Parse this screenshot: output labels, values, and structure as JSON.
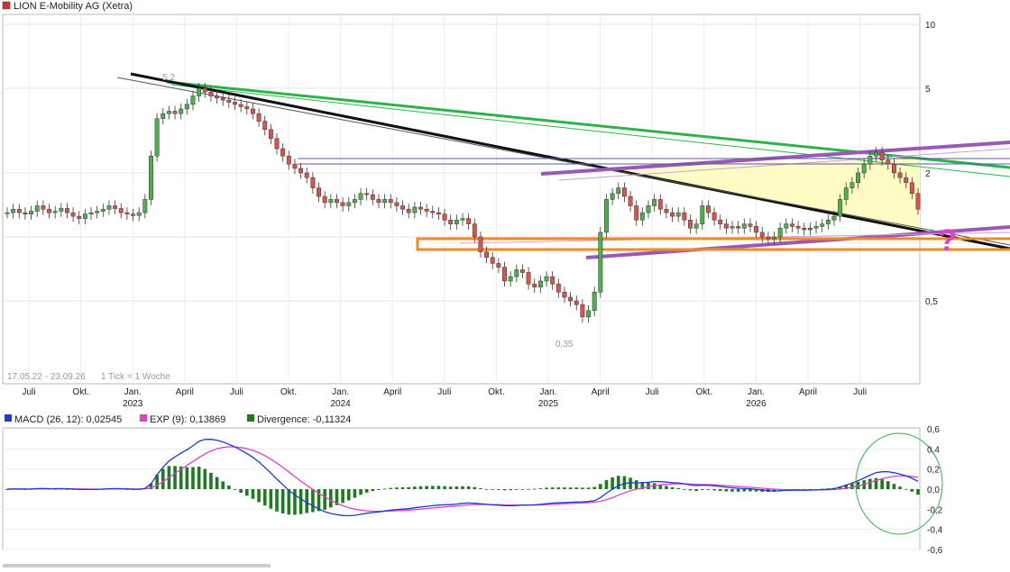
{
  "title": "LION E-Mobility AG (Xetra)",
  "title_color": "#d62d2d",
  "range_text": "17.05.22 - 23.09.26",
  "tick_text": "1 Tick = 1 Woche",
  "price_axis": {
    "labels": [
      "10",
      "5",
      "2",
      "0,5"
    ],
    "scale": "log",
    "range": [
      0.3,
      10
    ]
  },
  "annotations": {
    "high_label": "5,2",
    "low_label": "0,35",
    "question_mark": "?"
  },
  "time_axis": {
    "labels": [
      "Juli",
      "Okt.",
      "Jan.",
      "April",
      "Juli",
      "Okt.",
      "Jan.",
      "April",
      "Juli",
      "Okt.",
      "Jan.",
      "April",
      "Juli",
      "Okt.",
      "Jan.",
      "April",
      "Juli"
    ],
    "years": [
      "2023",
      "2024",
      "2025",
      "2026"
    ]
  },
  "macd_legend": {
    "macd_label": "MACD (26, 12): 0,02545",
    "macd_color": "#1a3ad6",
    "exp_label": "EXP (9): 0,13869",
    "exp_color": "#e040c8",
    "div_label": "Divergence: -0,11324",
    "div_color": "#1f7a1f"
  },
  "macd_axis": {
    "labels": [
      "0,6",
      "0,4",
      "0,2",
      "0,0",
      "-0,2",
      "-0,4",
      "-0,6"
    ],
    "range": [
      -0.6,
      0.6
    ]
  },
  "colors": {
    "up": "#4caf50",
    "down": "#d9534f",
    "green_line": "#2db34a",
    "purple_line": "#9b59b6",
    "orange_box": "#f08a24",
    "yellow_fill": "#fffbc4"
  },
  "chart_data": [
    {
      "type": "candlestick",
      "title": "LION E-Mobility AG (Xetra)",
      "yscale": "log",
      "ylim": [
        0.3,
        10
      ],
      "period": "17.05.22 - 23.09.26",
      "interval": "1 Woche",
      "approx_weekly_close": [
        1.3,
        1.35,
        1.3,
        1.28,
        1.32,
        1.4,
        1.35,
        1.3,
        1.32,
        1.36,
        1.3,
        1.25,
        1.22,
        1.28,
        1.3,
        1.32,
        1.35,
        1.4,
        1.36,
        1.3,
        1.28,
        1.26,
        1.3,
        1.5,
        2.4,
        3.6,
        3.8,
        3.9,
        3.8,
        4.0,
        4.2,
        4.6,
        5.0,
        4.8,
        4.6,
        4.5,
        4.4,
        4.3,
        4.2,
        4.1,
        4.0,
        3.8,
        3.5,
        3.2,
        2.9,
        2.6,
        2.4,
        2.2,
        2.1,
        2.0,
        1.9,
        1.7,
        1.55,
        1.45,
        1.5,
        1.45,
        1.4,
        1.45,
        1.5,
        1.6,
        1.58,
        1.5,
        1.45,
        1.5,
        1.45,
        1.4,
        1.35,
        1.3,
        1.38,
        1.35,
        1.32,
        1.3,
        1.28,
        1.2,
        1.15,
        1.2,
        1.22,
        1.15,
        1.0,
        0.85,
        0.8,
        0.75,
        0.72,
        0.62,
        0.65,
        0.7,
        0.68,
        0.6,
        0.58,
        0.62,
        0.65,
        0.6,
        0.55,
        0.52,
        0.5,
        0.48,
        0.42,
        0.45,
        0.55,
        1.05,
        1.5,
        1.6,
        1.7,
        1.55,
        1.4,
        1.2,
        1.3,
        1.4,
        1.5,
        1.35,
        1.3,
        1.25,
        1.3,
        1.2,
        1.1,
        1.15,
        1.4,
        1.3,
        1.2,
        1.15,
        1.1,
        1.12,
        1.1,
        1.15,
        1.12,
        1.05,
        1.0,
        0.98,
        1.0,
        1.1,
        1.15,
        1.12,
        1.1,
        1.08,
        1.1,
        1.12,
        1.15,
        1.2,
        1.25,
        1.5,
        1.7,
        1.8,
        2.0,
        2.2,
        2.4,
        2.5,
        2.3,
        2.2,
        2.0,
        1.9,
        1.8,
        1.6,
        1.35
      ],
      "marked_high": 5.2,
      "marked_low": 0.35
    },
    {
      "type": "line",
      "title": "MACD",
      "ylim": [
        -0.6,
        0.6
      ],
      "series": [
        {
          "name": "MACD (26, 12)",
          "last": 0.02545
        },
        {
          "name": "EXP (9)",
          "last": 0.13869
        },
        {
          "name": "Divergence",
          "last": -0.11324
        }
      ]
    }
  ]
}
